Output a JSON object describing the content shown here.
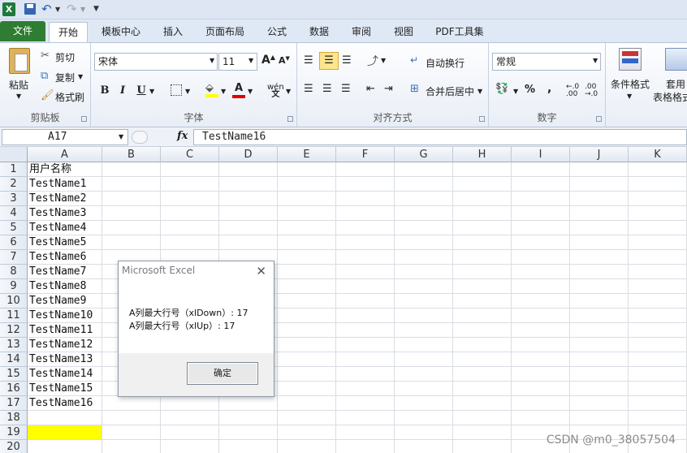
{
  "qat": {
    "excel_icon": "excel-logo",
    "save_icon": "floppy-disk",
    "undo_icon": "undo-arrow",
    "redo_icon": "redo-arrow",
    "customize_icon": "chevron-down"
  },
  "tabs": [
    "文件",
    "开始",
    "模板中心",
    "插入",
    "页面布局",
    "公式",
    "数据",
    "审阅",
    "视图",
    "PDF工具集"
  ],
  "ribbon": {
    "clipboard": {
      "paste": "粘贴",
      "cut": "剪切",
      "copy": "复制",
      "format_painter": "格式刷",
      "group_label": "剪贴板"
    },
    "font": {
      "font_name": "宋体",
      "font_size": "11",
      "group_label": "字体",
      "bold": "B",
      "italic": "I",
      "underline": "U",
      "font_color_label": "A"
    },
    "alignment": {
      "wrap": "自动换行",
      "merge": "合并后居中",
      "group_label": "对齐方式"
    },
    "number": {
      "format": "常规",
      "percent": "%",
      "comma": ",",
      "group_label": "数字"
    },
    "styles": {
      "conditional": "条件格式",
      "table_format_1": "套用",
      "table_format_2": "表格格式"
    }
  },
  "formula_bar": {
    "name_box": "A17",
    "fx": "fx",
    "content": "TestName16"
  },
  "columns": [
    "A",
    "B",
    "C",
    "D",
    "E",
    "F",
    "G",
    "H",
    "I",
    "J",
    "K"
  ],
  "rows": [
    "1",
    "2",
    "3",
    "4",
    "5",
    "6",
    "7",
    "8",
    "9",
    "10",
    "11",
    "12",
    "13",
    "14",
    "15",
    "16",
    "17",
    "18",
    "19",
    "20"
  ],
  "cells_a": [
    "用户名称",
    "TestName1",
    "TestName2",
    "TestName3",
    "TestName4",
    "TestName5",
    "TestName6",
    "TestName7",
    "TestName8",
    "TestName9",
    "TestName10",
    "TestName11",
    "TestName12",
    "TestName13",
    "TestName14",
    "TestName15",
    "TestName16"
  ],
  "highlight_color": "#ffff00",
  "dialog": {
    "title": "Microsoft Excel",
    "close": "✕",
    "line1": "A列最大行号（xlDown）: 17",
    "line2": "A列最大行号（xlUp）: 17",
    "ok": "确定"
  },
  "watermark": "CSDN @m0_38057504"
}
